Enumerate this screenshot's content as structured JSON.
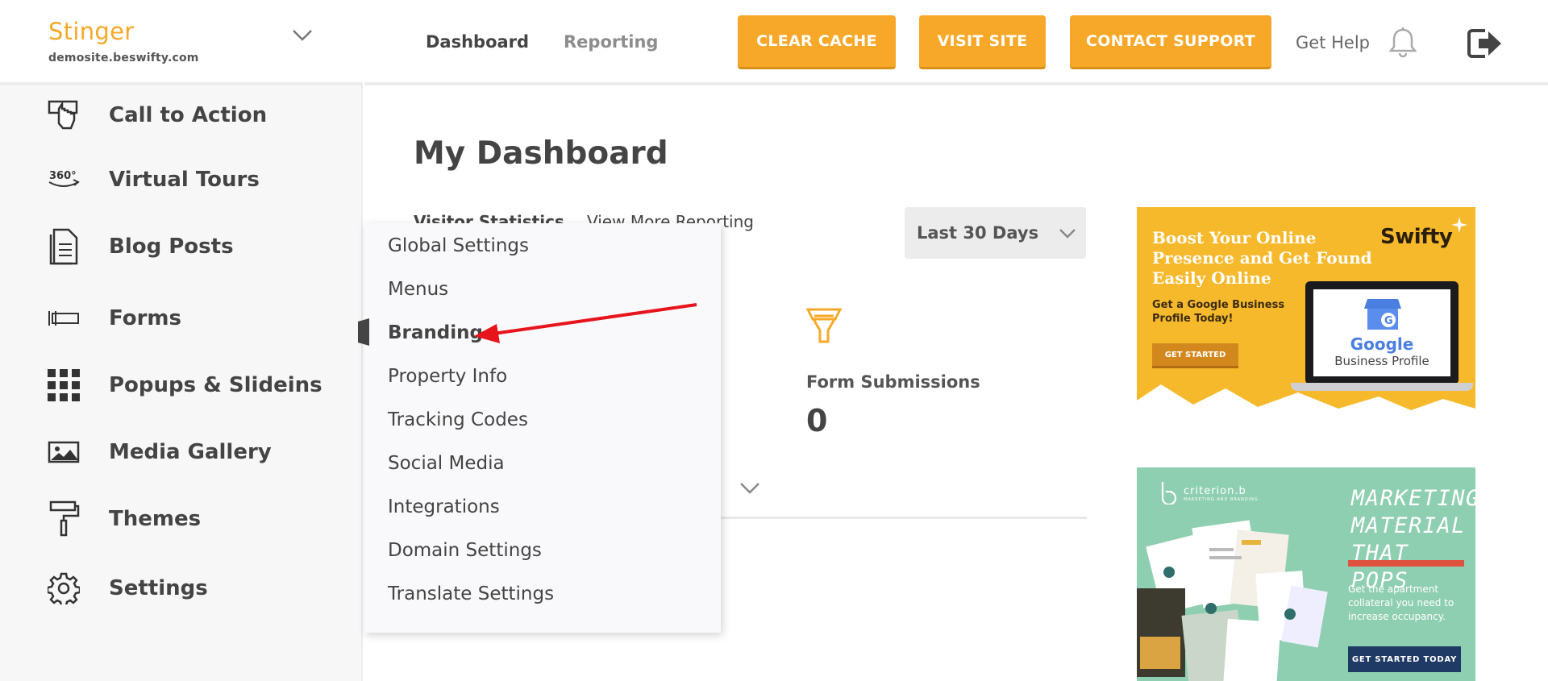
{
  "site": {
    "name": "Stinger",
    "url": "demosite.beswifty.com"
  },
  "sidebar": {
    "items": [
      {
        "label": "Call to Action",
        "icon": "call-to-action-icon"
      },
      {
        "label": "Virtual Tours",
        "icon": "360-tour-icon"
      },
      {
        "label": "Blog Posts",
        "icon": "document-icon"
      },
      {
        "label": "Forms",
        "icon": "form-field-icon"
      },
      {
        "label": "Popups & Slideins",
        "icon": "grid-icon"
      },
      {
        "label": "Media Gallery",
        "icon": "image-icon"
      },
      {
        "label": "Themes",
        "icon": "paint-roller-icon"
      },
      {
        "label": "Settings",
        "icon": "gear-icon"
      }
    ]
  },
  "header": {
    "tabs": [
      {
        "label": "Dashboard",
        "active": true
      },
      {
        "label": "Reporting",
        "active": false
      }
    ],
    "buttons": {
      "clear_cache": "CLEAR CACHE",
      "visit_site": "VISIT SITE",
      "contact_support": "CONTACT SUPPORT"
    },
    "get_help": "Get Help",
    "accent_color": "#f7a828"
  },
  "main": {
    "title": "My Dashboard",
    "visitor_stats_label": "Visitor Statistics",
    "view_more_label": "View More Reporting",
    "range_select": {
      "selected": "Last 30 Days"
    },
    "stats": [
      {
        "label": "Form Submissions",
        "value": "0",
        "icon": "funnel-icon"
      }
    ]
  },
  "settings_menu": {
    "items": [
      {
        "label": "Global Settings"
      },
      {
        "label": "Menus"
      },
      {
        "label": "Branding",
        "active": true
      },
      {
        "label": "Property Info"
      },
      {
        "label": "Tracking Codes"
      },
      {
        "label": "Social Media"
      },
      {
        "label": "Integrations"
      },
      {
        "label": "Domain Settings"
      },
      {
        "label": "Translate Settings"
      }
    ]
  },
  "ads": {
    "swifty": {
      "headline": "Boost Your Online Presence and Get Found Easily Online",
      "subtext": "Get a Google Business Profile Today!",
      "button": "GET STARTED",
      "brand": "Swifty",
      "google_word": "Google",
      "google_sub": "Business Profile"
    },
    "criterion": {
      "brand": "criterion.b",
      "brand_sub": "MARKETING AND BRANDING",
      "headline": "MARKETING MATERIAL THAT POPS",
      "body": "Get the apartment collateral you need to increase occupancy.",
      "button": "GET STARTED TODAY"
    }
  }
}
